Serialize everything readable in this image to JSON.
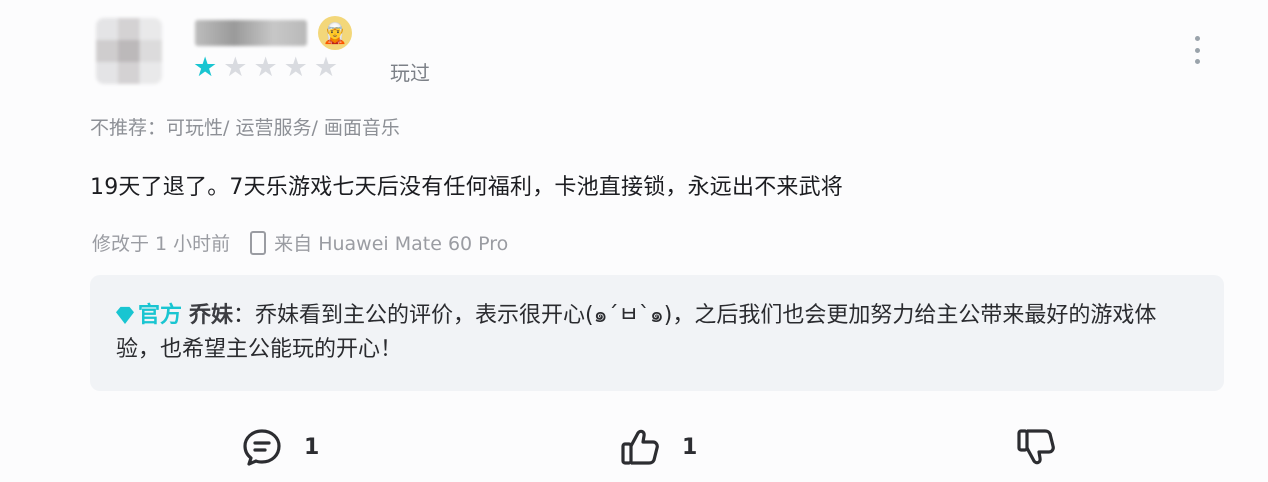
{
  "review": {
    "username": "████",
    "rating": 1,
    "rating_max": 5,
    "status": "玩过",
    "not_recommend": "不推荐：可玩性/ 运营服务/ 画面音乐",
    "text": "19天了退了。7天乐游戏七天后没有任何福利，卡池直接锁，永远出不来武将",
    "modified": "修改于 1 小时前",
    "device": "来自 Huawei Mate 60 Pro"
  },
  "reply": {
    "official_label": "官方",
    "replier": "乔妹",
    "separator": "：",
    "text": "乔妹看到主公的评价，表示很开心(๑´ㅂ`๑)，之后我们也会更加努力给主公带来最好的游戏体验，也希望主公能玩的开心！"
  },
  "actions": {
    "comment_count": "1",
    "like_count": "1"
  },
  "colors": {
    "accent": "#19c5d1",
    "star_off": "#d9dbe0"
  },
  "icons": [
    "avatar-badge-icon",
    "star-icon",
    "more-icon",
    "phone-icon",
    "verified-icon",
    "comment-icon",
    "thumbs-up-icon",
    "thumbs-down-icon"
  ]
}
